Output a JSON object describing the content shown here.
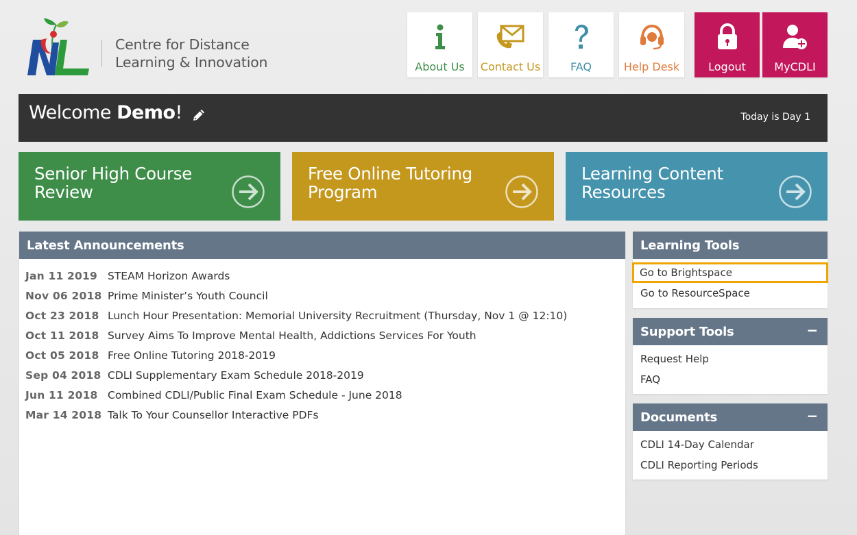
{
  "header": {
    "org_line1": "Centre for Distance",
    "org_line2": "Learning & Innovation",
    "logo_icon": "nl-logo-icon",
    "nav": [
      {
        "label": "About Us",
        "icon": "info-icon",
        "color": "#3e8e4a"
      },
      {
        "label": "Contact Us",
        "icon": "envelope-phone-icon",
        "color": "#c4971d"
      },
      {
        "label": "FAQ",
        "icon": "question-icon",
        "color": "#3f8fa9"
      },
      {
        "label": "Help Desk",
        "icon": "headset-icon",
        "color": "#e07b3c"
      },
      {
        "label": "Logout",
        "icon": "lock-icon",
        "color": "#c2185b"
      },
      {
        "label": "MyCDLI",
        "icon": "user-add-icon",
        "color": "#c2185b"
      }
    ]
  },
  "welcome": {
    "greeting": "Welcome ",
    "user": "Demo",
    "suffix": "!",
    "today": "Today is Day 1",
    "bar_color": "#333333"
  },
  "tiles": [
    {
      "title": "Senior High Course Review",
      "color": "#3e8e4a"
    },
    {
      "title": "Free Online Tutoring Program",
      "color": "#c4971d"
    },
    {
      "title": "Learning Content Resources",
      "color": "#4593ad"
    }
  ],
  "announcements": {
    "title": "Latest Announcements",
    "items": [
      {
        "date": "Jan 11 2019",
        "title": "STEAM Horizon Awards"
      },
      {
        "date": "Nov 06 2018",
        "title": "Prime Minister’s Youth Council"
      },
      {
        "date": "Oct 23 2018",
        "title": "Lunch Hour Presentation: Memorial University Recruitment (Thursday, Nov 1 @ 12:10)"
      },
      {
        "date": "Oct 11 2018",
        "title": "Survey Aims To Improve Mental Health, Addictions Services For Youth"
      },
      {
        "date": "Oct 05 2018",
        "title": "Free Online Tutoring 2018-2019"
      },
      {
        "date": "Sep 04 2018",
        "title": "CDLI Supplementary Exam Schedule 2018-2019"
      },
      {
        "date": "Jun 11 2018",
        "title": "Combined CDLI/Public Final Exam Schedule - June 2018"
      },
      {
        "date": "Mar 14 2018",
        "title": "Talk To Your Counsellor Interactive PDFs"
      }
    ]
  },
  "learning_tools": {
    "title": "Learning Tools",
    "items": [
      "Go to Brightspace",
      "Go to ResourceSpace"
    ]
  },
  "support_tools": {
    "title": "Support Tools",
    "collapse": "−",
    "items": [
      "Request Help",
      "FAQ"
    ]
  },
  "documents": {
    "title": "Documents",
    "collapse": "−",
    "items": [
      "CDLI 14-Day Calendar",
      "CDLI Reporting Periods"
    ]
  },
  "colors": {
    "panel_header": "#657689",
    "highlight_outline": "#f0a500"
  }
}
